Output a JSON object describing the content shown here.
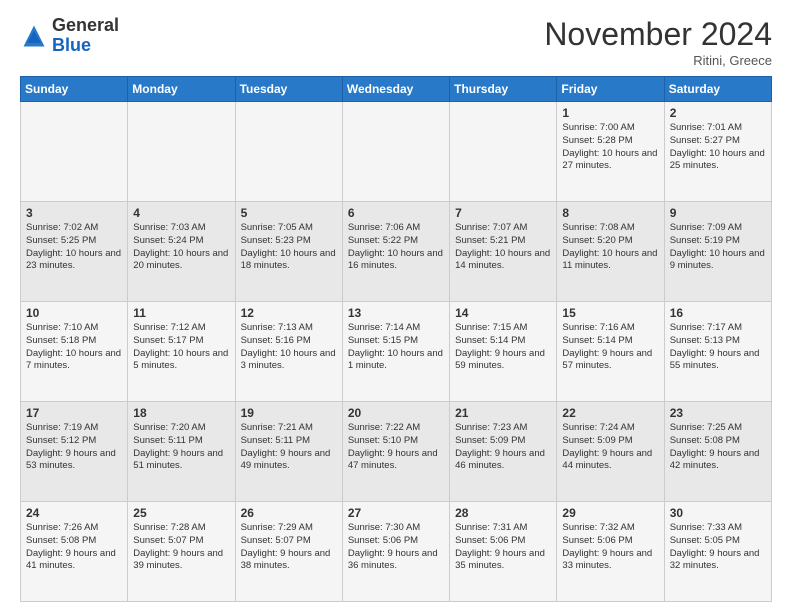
{
  "header": {
    "logo_general": "General",
    "logo_blue": "Blue",
    "month_title": "November 2024",
    "location": "Ritini, Greece"
  },
  "weekdays": [
    "Sunday",
    "Monday",
    "Tuesday",
    "Wednesday",
    "Thursday",
    "Friday",
    "Saturday"
  ],
  "weeks": [
    [
      {
        "day": "",
        "info": ""
      },
      {
        "day": "",
        "info": ""
      },
      {
        "day": "",
        "info": ""
      },
      {
        "day": "",
        "info": ""
      },
      {
        "day": "",
        "info": ""
      },
      {
        "day": "1",
        "info": "Sunrise: 7:00 AM\nSunset: 5:28 PM\nDaylight: 10 hours\nand 27 minutes."
      },
      {
        "day": "2",
        "info": "Sunrise: 7:01 AM\nSunset: 5:27 PM\nDaylight: 10 hours\nand 25 minutes."
      }
    ],
    [
      {
        "day": "3",
        "info": "Sunrise: 7:02 AM\nSunset: 5:25 PM\nDaylight: 10 hours\nand 23 minutes."
      },
      {
        "day": "4",
        "info": "Sunrise: 7:03 AM\nSunset: 5:24 PM\nDaylight: 10 hours\nand 20 minutes."
      },
      {
        "day": "5",
        "info": "Sunrise: 7:05 AM\nSunset: 5:23 PM\nDaylight: 10 hours\nand 18 minutes."
      },
      {
        "day": "6",
        "info": "Sunrise: 7:06 AM\nSunset: 5:22 PM\nDaylight: 10 hours\nand 16 minutes."
      },
      {
        "day": "7",
        "info": "Sunrise: 7:07 AM\nSunset: 5:21 PM\nDaylight: 10 hours\nand 14 minutes."
      },
      {
        "day": "8",
        "info": "Sunrise: 7:08 AM\nSunset: 5:20 PM\nDaylight: 10 hours\nand 11 minutes."
      },
      {
        "day": "9",
        "info": "Sunrise: 7:09 AM\nSunset: 5:19 PM\nDaylight: 10 hours\nand 9 minutes."
      }
    ],
    [
      {
        "day": "10",
        "info": "Sunrise: 7:10 AM\nSunset: 5:18 PM\nDaylight: 10 hours\nand 7 minutes."
      },
      {
        "day": "11",
        "info": "Sunrise: 7:12 AM\nSunset: 5:17 PM\nDaylight: 10 hours\nand 5 minutes."
      },
      {
        "day": "12",
        "info": "Sunrise: 7:13 AM\nSunset: 5:16 PM\nDaylight: 10 hours\nand 3 minutes."
      },
      {
        "day": "13",
        "info": "Sunrise: 7:14 AM\nSunset: 5:15 PM\nDaylight: 10 hours\nand 1 minute."
      },
      {
        "day": "14",
        "info": "Sunrise: 7:15 AM\nSunset: 5:14 PM\nDaylight: 9 hours\nand 59 minutes."
      },
      {
        "day": "15",
        "info": "Sunrise: 7:16 AM\nSunset: 5:14 PM\nDaylight: 9 hours\nand 57 minutes."
      },
      {
        "day": "16",
        "info": "Sunrise: 7:17 AM\nSunset: 5:13 PM\nDaylight: 9 hours\nand 55 minutes."
      }
    ],
    [
      {
        "day": "17",
        "info": "Sunrise: 7:19 AM\nSunset: 5:12 PM\nDaylight: 9 hours\nand 53 minutes."
      },
      {
        "day": "18",
        "info": "Sunrise: 7:20 AM\nSunset: 5:11 PM\nDaylight: 9 hours\nand 51 minutes."
      },
      {
        "day": "19",
        "info": "Sunrise: 7:21 AM\nSunset: 5:11 PM\nDaylight: 9 hours\nand 49 minutes."
      },
      {
        "day": "20",
        "info": "Sunrise: 7:22 AM\nSunset: 5:10 PM\nDaylight: 9 hours\nand 47 minutes."
      },
      {
        "day": "21",
        "info": "Sunrise: 7:23 AM\nSunset: 5:09 PM\nDaylight: 9 hours\nand 46 minutes."
      },
      {
        "day": "22",
        "info": "Sunrise: 7:24 AM\nSunset: 5:09 PM\nDaylight: 9 hours\nand 44 minutes."
      },
      {
        "day": "23",
        "info": "Sunrise: 7:25 AM\nSunset: 5:08 PM\nDaylight: 9 hours\nand 42 minutes."
      }
    ],
    [
      {
        "day": "24",
        "info": "Sunrise: 7:26 AM\nSunset: 5:08 PM\nDaylight: 9 hours\nand 41 minutes."
      },
      {
        "day": "25",
        "info": "Sunrise: 7:28 AM\nSunset: 5:07 PM\nDaylight: 9 hours\nand 39 minutes."
      },
      {
        "day": "26",
        "info": "Sunrise: 7:29 AM\nSunset: 5:07 PM\nDaylight: 9 hours\nand 38 minutes."
      },
      {
        "day": "27",
        "info": "Sunrise: 7:30 AM\nSunset: 5:06 PM\nDaylight: 9 hours\nand 36 minutes."
      },
      {
        "day": "28",
        "info": "Sunrise: 7:31 AM\nSunset: 5:06 PM\nDaylight: 9 hours\nand 35 minutes."
      },
      {
        "day": "29",
        "info": "Sunrise: 7:32 AM\nSunset: 5:06 PM\nDaylight: 9 hours\nand 33 minutes."
      },
      {
        "day": "30",
        "info": "Sunrise: 7:33 AM\nSunset: 5:05 PM\nDaylight: 9 hours\nand 32 minutes."
      }
    ]
  ]
}
